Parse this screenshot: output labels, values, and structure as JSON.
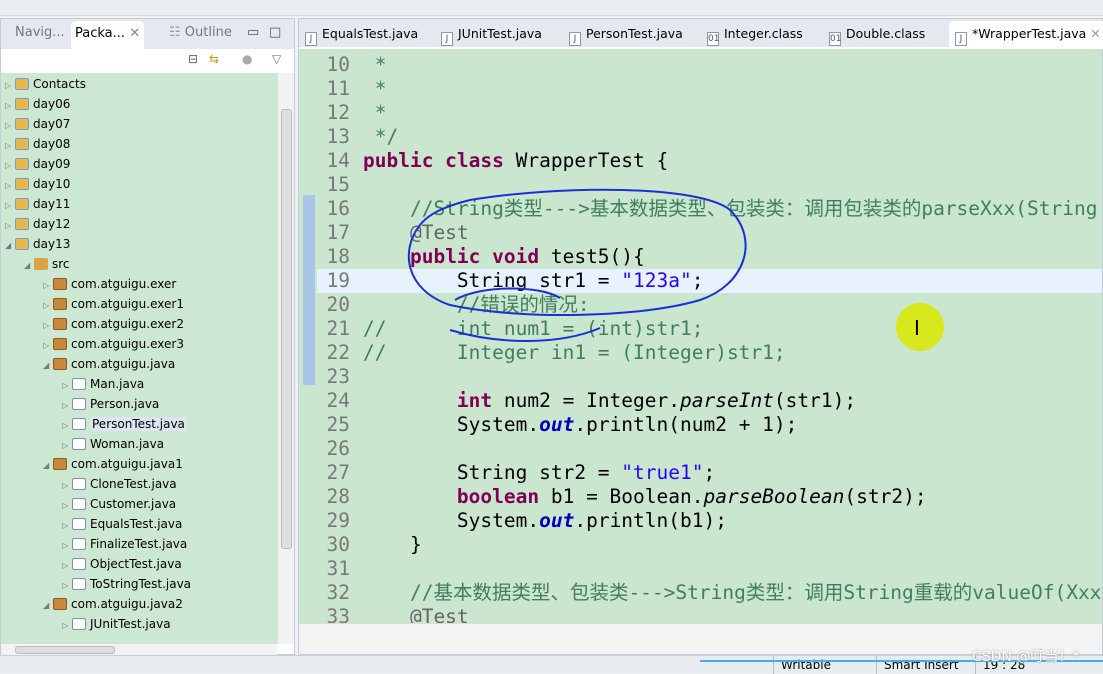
{
  "left_panel": {
    "tabs": [
      "Navig...",
      "Packa...",
      "Outline"
    ],
    "active_tab": 1,
    "tree": [
      {
        "label": "Contacts",
        "depth": 0,
        "icon": "proj",
        "tw": "▷"
      },
      {
        "label": "day06",
        "depth": 0,
        "icon": "proj",
        "tw": "▷"
      },
      {
        "label": "day07",
        "depth": 0,
        "icon": "proj",
        "tw": "▷"
      },
      {
        "label": "day08",
        "depth": 0,
        "icon": "proj",
        "tw": "▷"
      },
      {
        "label": "day09",
        "depth": 0,
        "icon": "proj",
        "tw": "▷"
      },
      {
        "label": "day10",
        "depth": 0,
        "icon": "proj",
        "tw": "▷"
      },
      {
        "label": "day11",
        "depth": 0,
        "icon": "proj",
        "tw": "▷"
      },
      {
        "label": "day12",
        "depth": 0,
        "icon": "proj",
        "tw": "▷"
      },
      {
        "label": "day13",
        "depth": 0,
        "icon": "proj",
        "tw": "◢"
      },
      {
        "label": "src",
        "depth": 1,
        "icon": "src",
        "tw": "◢"
      },
      {
        "label": "com.atguigu.exer",
        "depth": 2,
        "icon": "pkg",
        "tw": "▷"
      },
      {
        "label": "com.atguigu.exer1",
        "depth": 2,
        "icon": "pkg",
        "tw": "▷"
      },
      {
        "label": "com.atguigu.exer2",
        "depth": 2,
        "icon": "pkg",
        "tw": "▷"
      },
      {
        "label": "com.atguigu.exer3",
        "depth": 2,
        "icon": "pkg",
        "tw": "▷"
      },
      {
        "label": "com.atguigu.java",
        "depth": 2,
        "icon": "pkg",
        "tw": "◢"
      },
      {
        "label": "Man.java",
        "depth": 3,
        "icon": "java",
        "tw": "▷"
      },
      {
        "label": "Person.java",
        "depth": 3,
        "icon": "java",
        "tw": "▷"
      },
      {
        "label": "PersonTest.java",
        "depth": 3,
        "icon": "java",
        "tw": "▷",
        "selected": true
      },
      {
        "label": "Woman.java",
        "depth": 3,
        "icon": "java",
        "tw": "▷"
      },
      {
        "label": "com.atguigu.java1",
        "depth": 2,
        "icon": "pkg",
        "tw": "◢"
      },
      {
        "label": "CloneTest.java",
        "depth": 3,
        "icon": "java",
        "tw": "▷"
      },
      {
        "label": "Customer.java",
        "depth": 3,
        "icon": "java",
        "tw": "▷"
      },
      {
        "label": "EqualsTest.java",
        "depth": 3,
        "icon": "java",
        "tw": "▷"
      },
      {
        "label": "FinalizeTest.java",
        "depth": 3,
        "icon": "java",
        "tw": "▷"
      },
      {
        "label": "ObjectTest.java",
        "depth": 3,
        "icon": "java",
        "tw": "▷"
      },
      {
        "label": "ToStringTest.java",
        "depth": 3,
        "icon": "java",
        "tw": "▷"
      },
      {
        "label": "com.atguigu.java2",
        "depth": 2,
        "icon": "pkg",
        "tw": "◢"
      },
      {
        "label": "JUnitTest.java",
        "depth": 3,
        "icon": "java",
        "tw": "▷"
      }
    ]
  },
  "editor": {
    "tabs": [
      {
        "label": "EqualsTest.java",
        "icon": "J"
      },
      {
        "label": "JUnitTest.java",
        "icon": "J"
      },
      {
        "label": "PersonTest.java",
        "icon": "J"
      },
      {
        "label": "Integer.class",
        "icon": "01"
      },
      {
        "label": "Double.class",
        "icon": "01"
      },
      {
        "label": "*WrapperTest.java",
        "icon": "J",
        "active": true
      }
    ],
    "current_line": 19,
    "lines": [
      {
        "n": "10",
        "seg": [
          [
            " *",
            "cm"
          ]
        ]
      },
      {
        "n": "11",
        "seg": [
          [
            " *",
            "cm"
          ]
        ]
      },
      {
        "n": "12",
        "seg": [
          [
            " *",
            "cm"
          ]
        ]
      },
      {
        "n": "13",
        "seg": [
          [
            " */",
            "cm"
          ]
        ]
      },
      {
        "n": "14",
        "seg": [
          [
            "public class",
            "kw"
          ],
          [
            " WrapperTest {",
            ""
          ]
        ]
      },
      {
        "n": "15",
        "seg": []
      },
      {
        "n": "16",
        "seg": [
          [
            "    //String类型--->基本数据类型、包装类：调用包装类的parseXxx(String s)",
            "cm"
          ]
        ]
      },
      {
        "n": "17",
        "seg": [
          [
            "    @Test",
            "ann"
          ]
        ]
      },
      {
        "n": "18",
        "seg": [
          [
            "    ",
            ""
          ],
          [
            "public void",
            "kw"
          ],
          [
            " test5(){",
            ""
          ]
        ]
      },
      {
        "n": "19",
        "seg": [
          [
            "        String str1 = ",
            ""
          ],
          [
            "\"123a\"",
            "str"
          ],
          [
            ";",
            ""
          ]
        ]
      },
      {
        "n": "20",
        "seg": [
          [
            "        //错误的情况:",
            "cm"
          ]
        ]
      },
      {
        "n": "21",
        "seg": [
          [
            "//      int num1 = (int)str1;",
            "cm"
          ]
        ]
      },
      {
        "n": "22",
        "seg": [
          [
            "//      Integer in1 = (Integer)str1;",
            "cm"
          ]
        ]
      },
      {
        "n": "23",
        "seg": []
      },
      {
        "n": "24",
        "seg": [
          [
            "        ",
            ""
          ],
          [
            "int",
            "kw"
          ],
          [
            " num2 = Integer.",
            ""
          ],
          [
            "parseInt",
            "st"
          ],
          [
            "(str1);",
            ""
          ]
        ]
      },
      {
        "n": "25",
        "seg": [
          [
            "        System.",
            ""
          ],
          [
            "out",
            "fld"
          ],
          [
            ".println(num2 + 1);",
            ""
          ]
        ]
      },
      {
        "n": "26",
        "seg": []
      },
      {
        "n": "27",
        "seg": [
          [
            "        String str2 = ",
            ""
          ],
          [
            "\"true1\"",
            "str"
          ],
          [
            ";",
            ""
          ]
        ]
      },
      {
        "n": "28",
        "seg": [
          [
            "        ",
            ""
          ],
          [
            "boolean",
            "kw"
          ],
          [
            " b1 = Boolean.",
            ""
          ],
          [
            "parseBoolean",
            "st"
          ],
          [
            "(str2);",
            ""
          ]
        ]
      },
      {
        "n": "29",
        "seg": [
          [
            "        System.",
            ""
          ],
          [
            "out",
            "fld"
          ],
          [
            ".println(b1);",
            ""
          ]
        ]
      },
      {
        "n": "30",
        "seg": [
          [
            "    }",
            ""
          ]
        ]
      },
      {
        "n": "31",
        "seg": []
      },
      {
        "n": "32",
        "seg": [
          [
            "    //基本数据类型、包装类--->String类型：调用String重载的valueOf(Xxx xxx)",
            "cm"
          ]
        ]
      },
      {
        "n": "33",
        "seg": [
          [
            "    @Test",
            "ann"
          ]
        ]
      }
    ]
  },
  "status": {
    "writable": "Writable",
    "insert_mode": "Smart Insert",
    "position": "19 : 28"
  },
  "watermark": "CSDN @叮当！*"
}
